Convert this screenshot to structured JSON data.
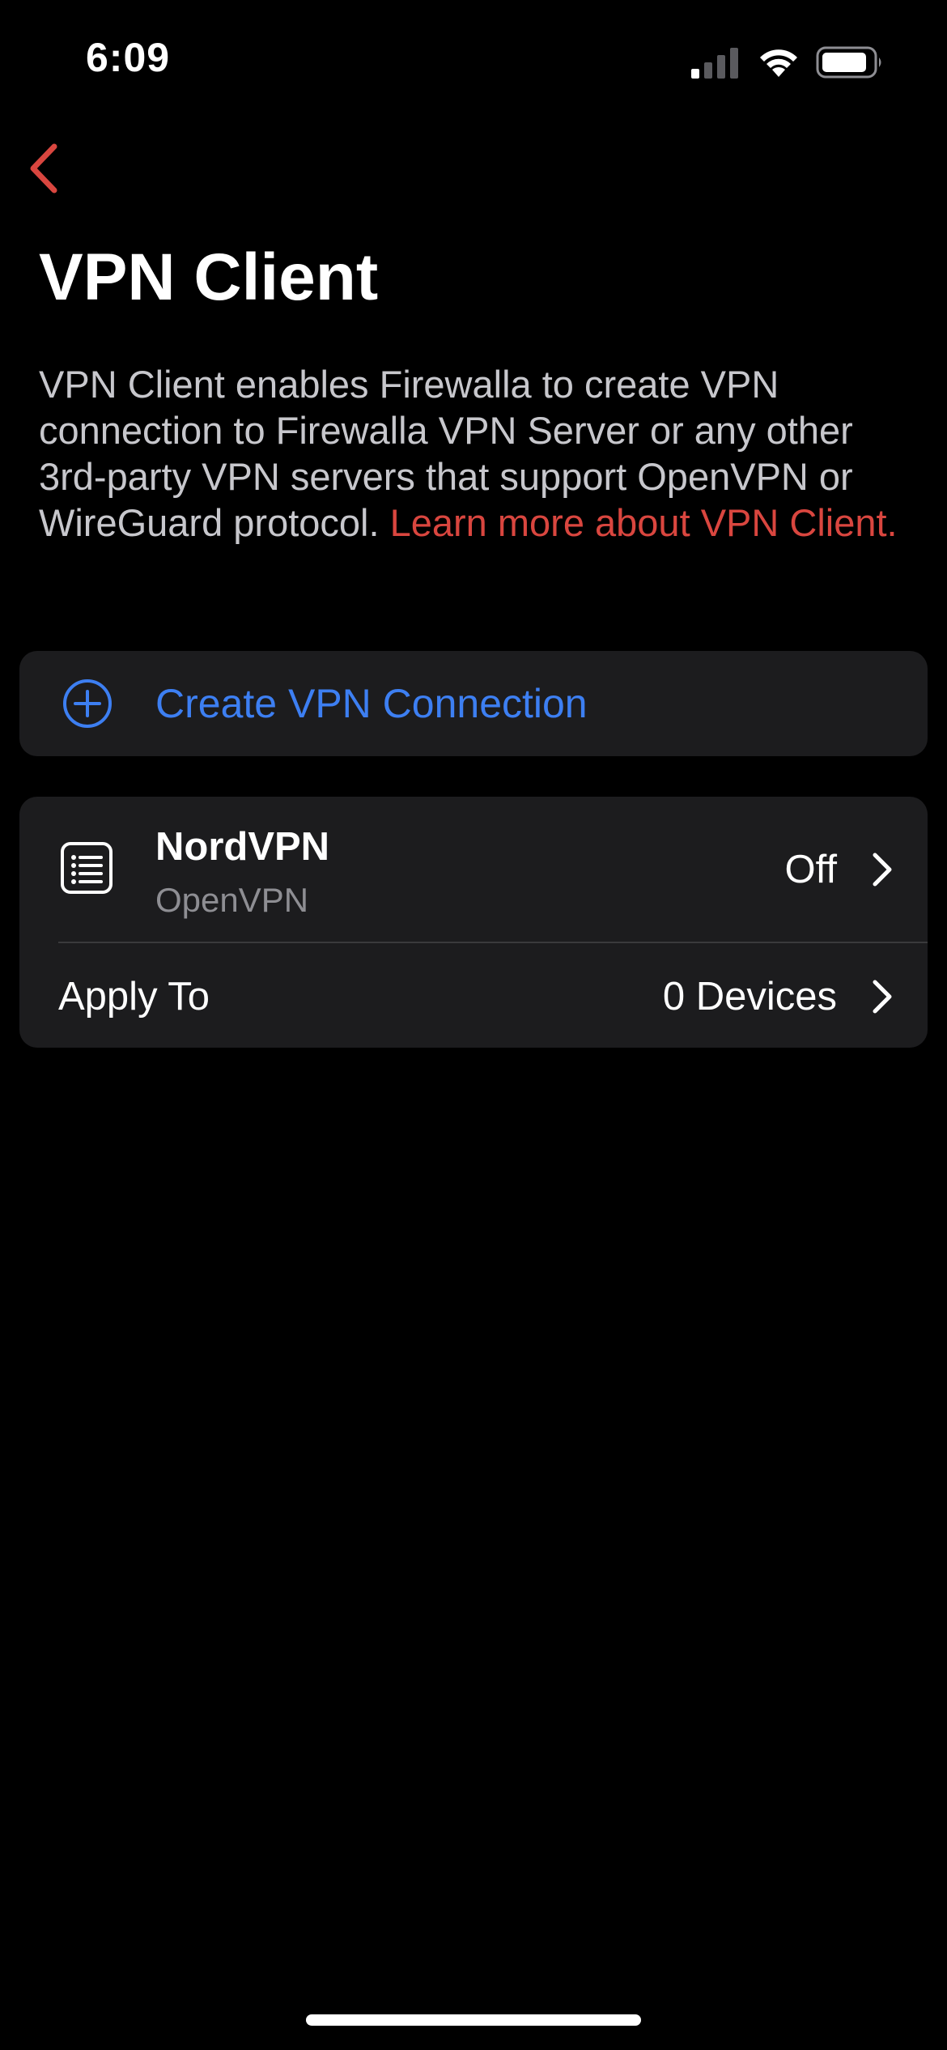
{
  "status_bar": {
    "time": "6:09",
    "icons": [
      "signal-icon",
      "wifi-icon",
      "battery-icon"
    ]
  },
  "nav": {
    "back_icon": "chevron-left-icon"
  },
  "page": {
    "title": "VPN Client",
    "description": "VPN Client enables Firewalla to create VPN connection to Firewalla VPN Server or any other 3rd-party VPN servers that support OpenVPN or WireGuard protocol. ",
    "learn_more_link": "Learn more about VPN Client."
  },
  "create_connection": {
    "icon": "plus-circle-icon",
    "label": "Create VPN Connection"
  },
  "connections": [
    {
      "icon": "list-icon",
      "name": "NordVPN",
      "protocol": "OpenVPN",
      "status": "Off",
      "apply_to_label": "Apply To",
      "apply_to_value": "0 Devices"
    }
  ],
  "colors": {
    "background": "#000000",
    "card": "#1c1c1e",
    "accent_red": "#d9463f",
    "accent_blue": "#3d7ff2",
    "secondary_text": "#8e8e93"
  }
}
